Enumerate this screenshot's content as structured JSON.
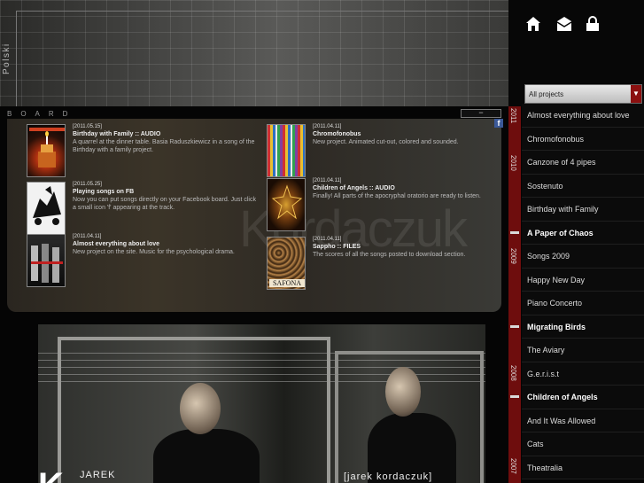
{
  "header": {
    "language_link": "Polski",
    "icons": [
      "home-icon",
      "mail-icon",
      "lock-icon"
    ]
  },
  "filter": {
    "selected": "All projects",
    "arrow": "▼"
  },
  "board": {
    "label": "BOARD",
    "minimize": "−",
    "facebook": "f",
    "watermark": "Kordaczuk",
    "posts": [
      {
        "date": "[2011.05.15]",
        "title": "Birthday with Family :: AUDIO",
        "desc": "A quarrel at the dinner table. Basia Raduszkiewicz in a song of the Birthday with a family project."
      },
      {
        "date": "[2011.05.25]",
        "title": "Playing songs on FB",
        "desc": "Now you can put songs directly on your Facebook board. Just click a small icon 'f' appearing at the track."
      },
      {
        "date": "[2011.04.11]",
        "title": "Almost everything about love",
        "desc": "New project on the site. Music for the psychological drama."
      },
      {
        "date": "[2011.04.11]",
        "title": "Chromofonobus",
        "desc": "New project. Animated cut-out, colored and sounded."
      },
      {
        "date": "[2011.04.11]",
        "title": "Children of Angels :: AUDIO",
        "desc": "Finally! All parts of the apocryphal oratorio are ready to listen."
      },
      {
        "date": "[2011.04.11]",
        "title": "Sappho :: FILES",
        "desc": "The scores of all the songs posted to download section."
      }
    ],
    "thumb_text_sappho": "SAFONA"
  },
  "photo": {
    "caption_left": "JAREK",
    "caption_right": "[jarek kordaczuk]",
    "big_letter": "K"
  },
  "timeline": {
    "years": [
      "2011",
      "2010",
      "2009",
      "2008",
      "2007"
    ]
  },
  "projects": [
    {
      "label": "Almost everything about love",
      "bold": false
    },
    {
      "label": "Chromofonobus",
      "bold": false
    },
    {
      "label": "Canzone of 4 pipes",
      "bold": false
    },
    {
      "label": "Sostenuto",
      "bold": false
    },
    {
      "label": "Birthday with Family",
      "bold": false
    },
    {
      "label": "A Paper of Chaos",
      "bold": true
    },
    {
      "label": "Songs 2009",
      "bold": false
    },
    {
      "label": "Happy New Day",
      "bold": false
    },
    {
      "label": "Piano Concerto",
      "bold": false
    },
    {
      "label": "Migrating Birds",
      "bold": true
    },
    {
      "label": "The Aviary",
      "bold": false
    },
    {
      "label": "G.e.r.i.s.t",
      "bold": false
    },
    {
      "label": "Children of Angels",
      "bold": true
    },
    {
      "label": "And It Was Allowed",
      "bold": false
    },
    {
      "label": "Cats",
      "bold": false
    },
    {
      "label": "Theatralia",
      "bold": false
    }
  ],
  "colors": {
    "timeline": "#6e0d0d",
    "facebook": "#3b5998",
    "select_arrow": "#8b1010"
  }
}
